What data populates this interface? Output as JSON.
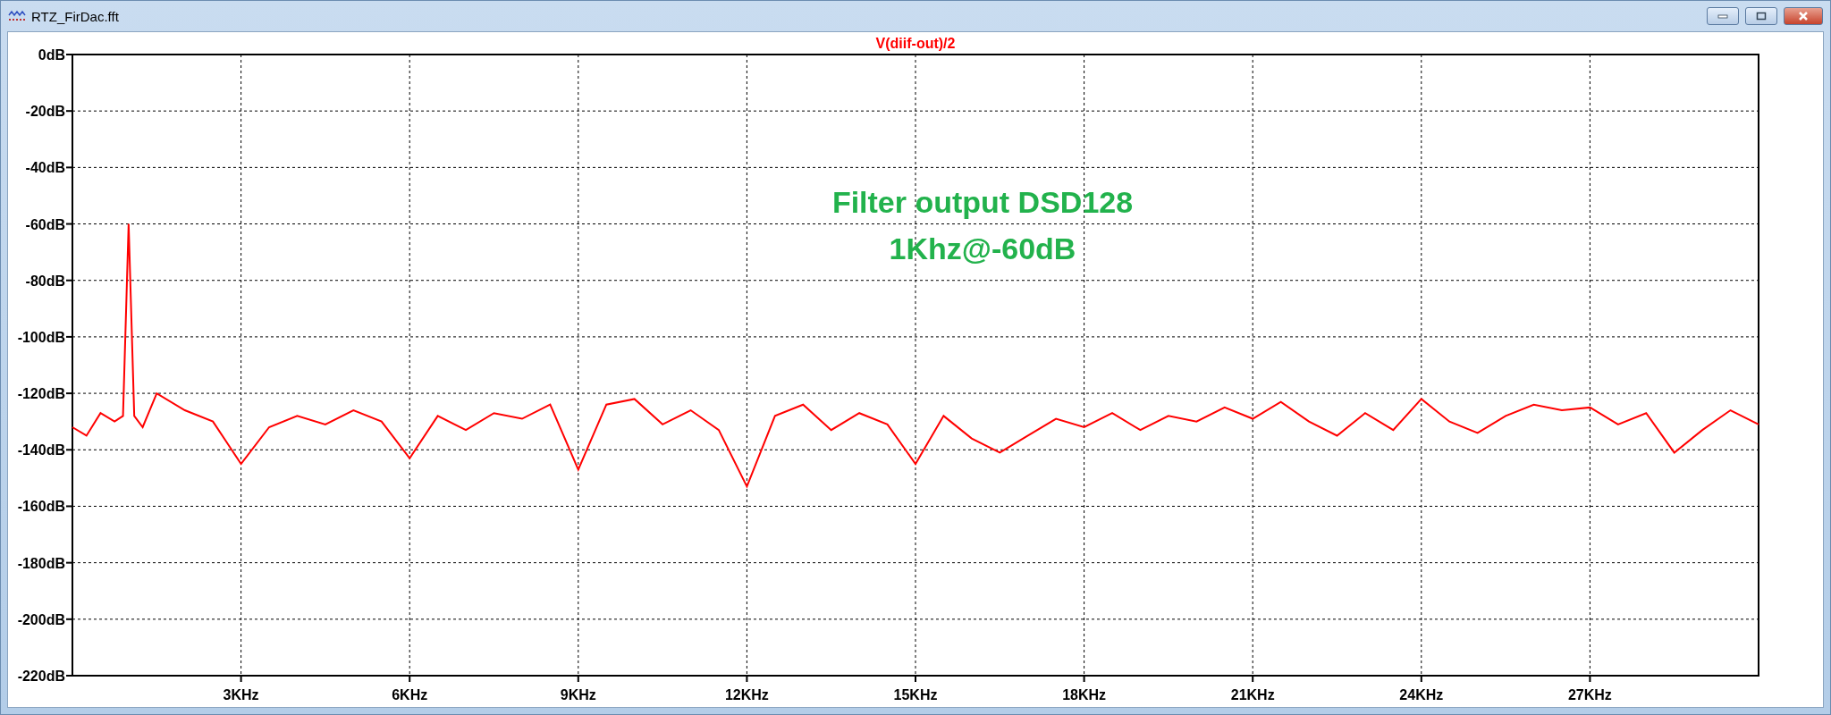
{
  "window": {
    "title": "RTZ_FirDac.fft"
  },
  "plot": {
    "chart_data": {
      "type": "line",
      "grid": true,
      "xlim": [
        0,
        30
      ],
      "ylim": [
        -220,
        0
      ],
      "xticks": [
        {
          "value": 3,
          "label": "3KHz"
        },
        {
          "value": 6,
          "label": "6KHz"
        },
        {
          "value": 9,
          "label": "9KHz"
        },
        {
          "value": 12,
          "label": "12KHz"
        },
        {
          "value": 15,
          "label": "15KHz"
        },
        {
          "value": 18,
          "label": "18KHz"
        },
        {
          "value": 21,
          "label": "21KHz"
        },
        {
          "value": 24,
          "label": "24KHz"
        },
        {
          "value": 27,
          "label": "27KHz"
        }
      ],
      "yticks": [
        {
          "value": 0,
          "label": "0dB"
        },
        {
          "value": -20,
          "label": "-20dB"
        },
        {
          "value": -40,
          "label": "-40dB"
        },
        {
          "value": -60,
          "label": "-60dB"
        },
        {
          "value": -80,
          "label": "-80dB"
        },
        {
          "value": -100,
          "label": "-100dB"
        },
        {
          "value": -120,
          "label": "-120dB"
        },
        {
          "value": -140,
          "label": "-140dB"
        },
        {
          "value": -160,
          "label": "-160dB"
        },
        {
          "value": -180,
          "label": "-180dB"
        },
        {
          "value": -200,
          "label": "-200dB"
        },
        {
          "value": -220,
          "label": "-220dB"
        }
      ],
      "x": [
        0,
        0.25,
        0.5,
        0.75,
        0.9,
        1,
        1.1,
        1.25,
        1.5,
        2,
        2.5,
        3,
        3.5,
        4,
        4.5,
        5,
        5.5,
        6,
        6.5,
        7,
        7.5,
        8,
        8.5,
        9,
        9.5,
        10,
        10.5,
        11,
        11.5,
        12,
        12.5,
        13,
        13.5,
        14,
        14.5,
        15,
        15.5,
        16,
        16.5,
        17,
        17.5,
        18,
        18.5,
        19,
        19.5,
        20,
        20.5,
        21,
        21.5,
        22,
        22.5,
        23,
        23.5,
        24,
        24.5,
        25,
        25.5,
        26,
        26.5,
        27,
        27.5,
        28,
        28.5,
        29,
        29.5,
        30
      ],
      "series": [
        {
          "name": "V(diif-out)/2",
          "color": "#ff0000",
          "values": [
            -132,
            -135,
            -127,
            -130,
            -128,
            -60,
            -128,
            -132,
            -120,
            -126,
            -130,
            -145,
            -132,
            -128,
            -131,
            -126,
            -130,
            -143,
            -128,
            -133,
            -127,
            -129,
            -124,
            -147,
            -124,
            -122,
            -131,
            -126,
            -133,
            -153,
            -128,
            -124,
            -133,
            -127,
            -131,
            -145,
            -128,
            -136,
            -141,
            -135,
            -129,
            -132,
            -127,
            -133,
            -128,
            -130,
            -125,
            -129,
            -123,
            -130,
            -135,
            -127,
            -133,
            -122,
            -130,
            -134,
            -128,
            -124,
            -126,
            -125,
            -131,
            -127,
            -141,
            -133,
            -126,
            -131
          ]
        }
      ],
      "annotations": [
        "Filter output DSD128",
        "1Khz@-60dB"
      ]
    }
  }
}
